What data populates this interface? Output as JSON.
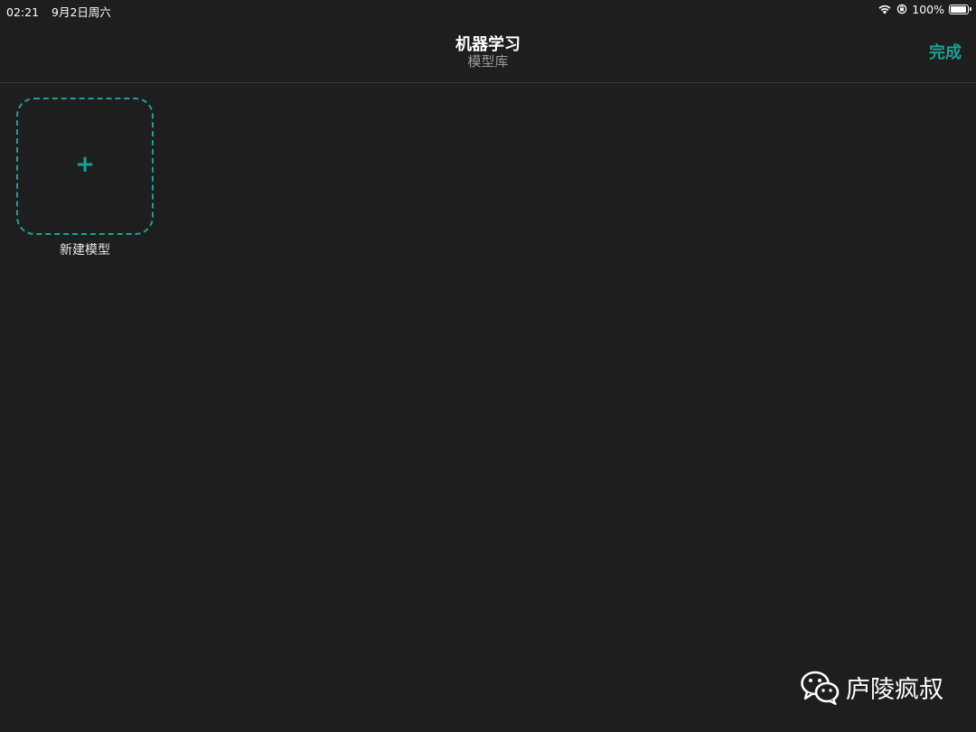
{
  "status_bar": {
    "time": "02:21",
    "date": "9月2日周六",
    "battery_percent": "100%",
    "battery_level": 1.0,
    "icons": [
      "wifi-icon",
      "orientation-lock-icon",
      "battery-icon"
    ]
  },
  "nav": {
    "title": "机器学习",
    "subtitle": "模型库",
    "done_label": "完成"
  },
  "library": {
    "new_model_label": "新建模型",
    "plus_glyph": "+"
  },
  "watermark": {
    "text": "庐陵疯叔",
    "icon": "wechat-icon"
  },
  "colors": {
    "accent": "#1aa196",
    "background": "#1e1e1e",
    "subtitle": "#9a9a9a"
  }
}
